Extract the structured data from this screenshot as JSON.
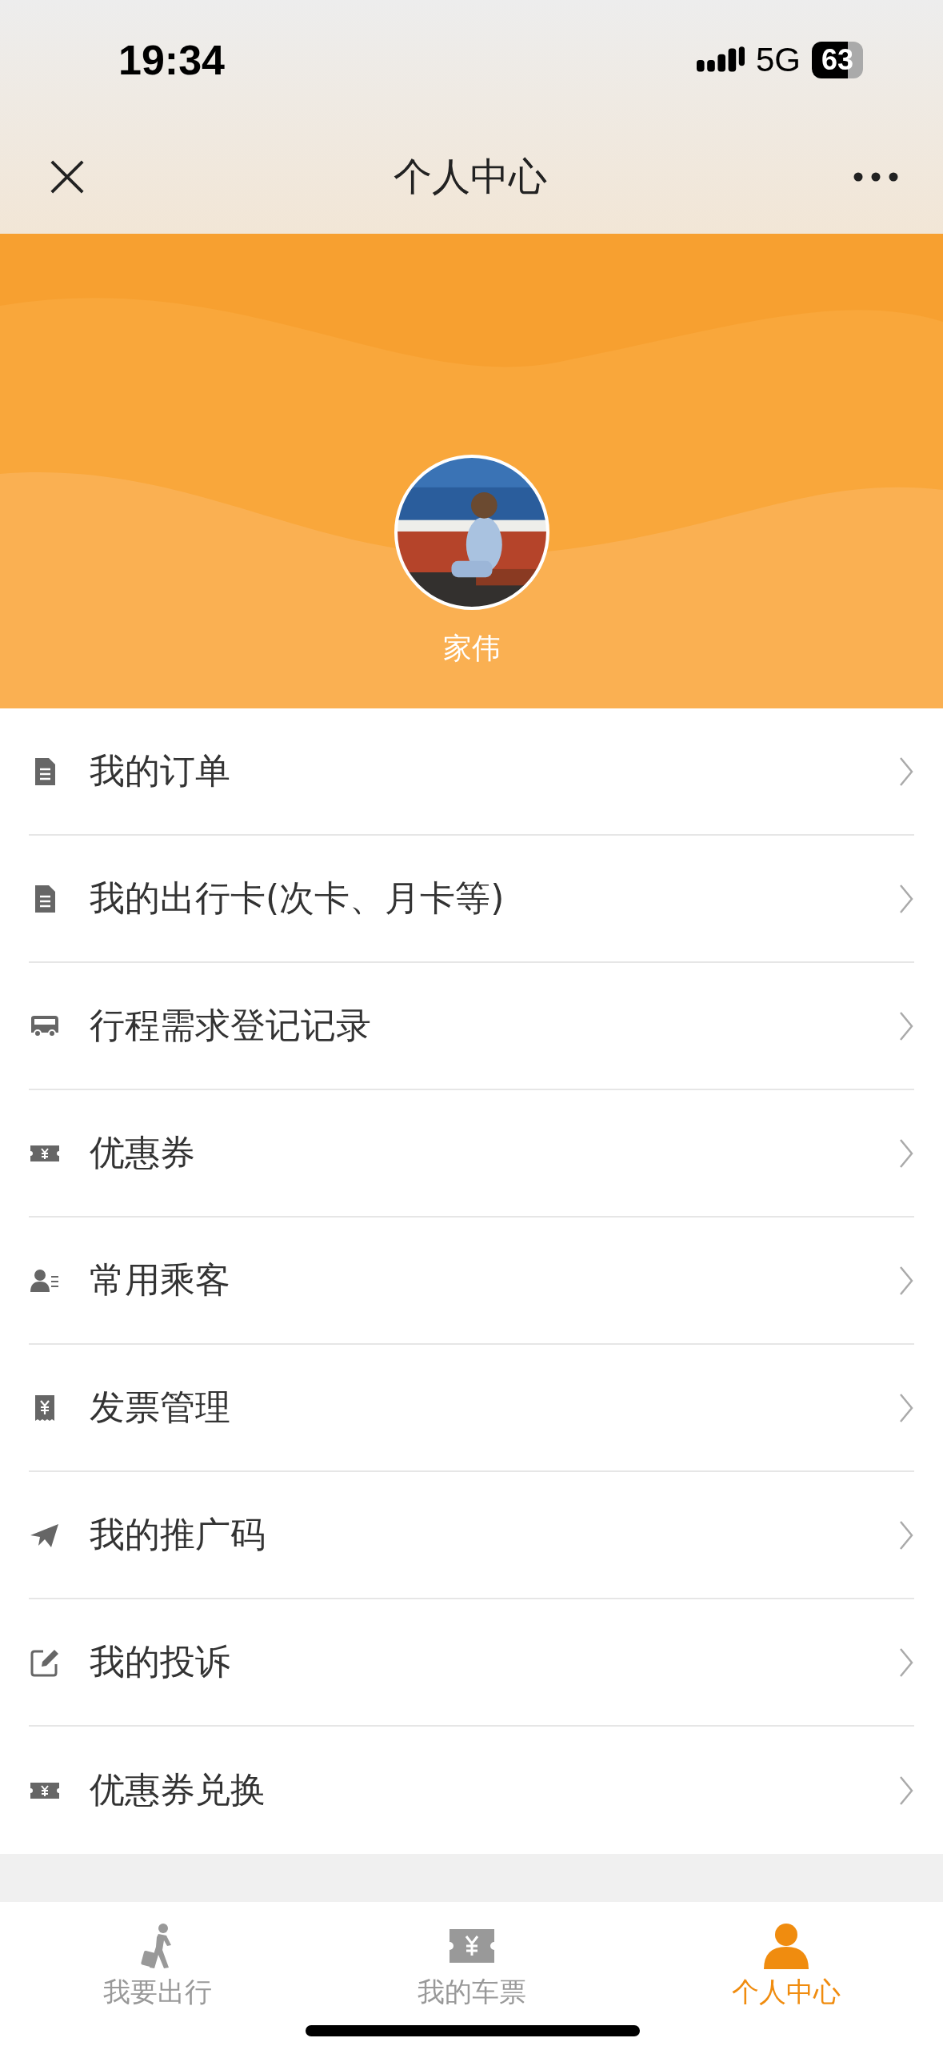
{
  "status_bar": {
    "time": "19:34",
    "network": "5G",
    "battery": "63"
  },
  "nav": {
    "title": "个人中心"
  },
  "profile": {
    "name": "家伟"
  },
  "menu": [
    {
      "label": "我的订单",
      "kind": "document"
    },
    {
      "label": "我的出行卡(次卡、月卡等)",
      "kind": "document"
    },
    {
      "label": "行程需求登记记录",
      "kind": "bus"
    },
    {
      "label": "优惠券",
      "kind": "ticket"
    },
    {
      "label": "常用乘客",
      "kind": "contact"
    },
    {
      "label": "发票管理",
      "kind": "invoice"
    },
    {
      "label": "我的推广码",
      "kind": "plane"
    },
    {
      "label": "我的投诉",
      "kind": "edit"
    },
    {
      "label": "优惠券兑换",
      "kind": "ticket"
    }
  ],
  "tabs": [
    {
      "label": "我要出行",
      "kind": "walker",
      "selected": false
    },
    {
      "label": "我的车票",
      "kind": "ticket",
      "selected": false
    },
    {
      "label": "个人中心",
      "kind": "person",
      "selected": true
    }
  ]
}
